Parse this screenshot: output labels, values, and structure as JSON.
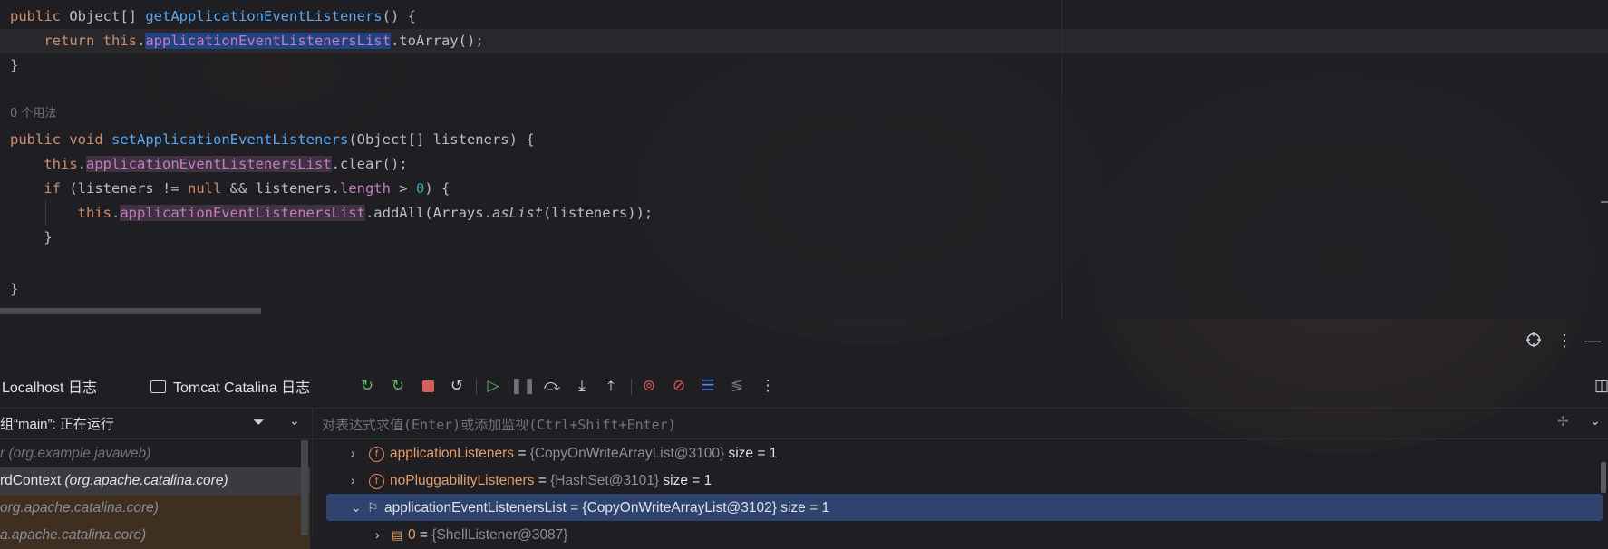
{
  "editor": {
    "line1": {
      "kw": "public",
      "type": "Object[]",
      "method": "getApplicationEventListeners",
      "tail": "() {"
    },
    "line2": {
      "kw": "return",
      "this": "this",
      "field": "applicationEventListenersList",
      "tail": ".toArray();"
    },
    "line3": "}",
    "usage_hint": "0 个用法",
    "line5": {
      "kw1": "public",
      "kw2": "void",
      "method": "setApplicationEventListeners",
      "params": "(Object[] listeners) {"
    },
    "line6": {
      "this": "this",
      "field": "applicationEventListenersList",
      "tail": ".clear();"
    },
    "line7": {
      "kw": "if",
      "a": " (listeners != ",
      "null": "null",
      "b": " && listeners.",
      "length": "length",
      "c": " > ",
      "zero": "0",
      "d": ") {"
    },
    "line8": {
      "this": "this",
      "field": "applicationEventListenersList",
      "mid": ".addAll(Arrays.",
      "call": "asList",
      "tail": "(listeners));"
    },
    "line9": "}",
    "line11": "}"
  },
  "debug": {
    "tabs": {
      "localhost": "Localhost 日志",
      "catalina": "Tomcat Catalina 日志"
    },
    "thread_label": "组“main”: 正在运行",
    "eval_placeholder": "对表达式求值(Enter)或添加监视(Ctrl+Shift+Enter)",
    "frames": [
      {
        "text": "r (org.example.javaweb)",
        "selected": false
      },
      {
        "text_plain": "rdContext ",
        "text_italic": "(org.apache.catalina.core)",
        "selected": true
      },
      {
        "text": "org.apache.catalina.core)",
        "selected": false
      },
      {
        "text": "a.apache.catalina.core)",
        "selected": false
      }
    ],
    "variables": [
      {
        "name": "applicationListeners",
        "eq": " = ",
        "value": "{CopyOnWriteArrayList@3100}",
        "size": "size = 1",
        "icon": "field-icon",
        "expanded": false
      },
      {
        "name": "noPluggabilityListeners",
        "eq": " = ",
        "value": "{HashSet@3101}",
        "size": "size = 1",
        "icon": "field-icon",
        "expanded": false
      },
      {
        "name": "applicationEventListenersList",
        "eq": " = ",
        "value": "{CopyOnWriteArrayList@3102}",
        "size": "size = 1",
        "icon": "flag-icon",
        "expanded": true,
        "selected": true
      },
      {
        "name": "0",
        "eq": " = ",
        "value": "{ShellListener@3087}",
        "icon": "element-icon",
        "expanded": false
      }
    ]
  },
  "colors": {
    "keyword": "#cf8e6d",
    "method": "#56a8f5",
    "field": "#c77dbb",
    "number": "#2aacb8",
    "selection": "#214283",
    "var_selected": "#2e436e"
  }
}
